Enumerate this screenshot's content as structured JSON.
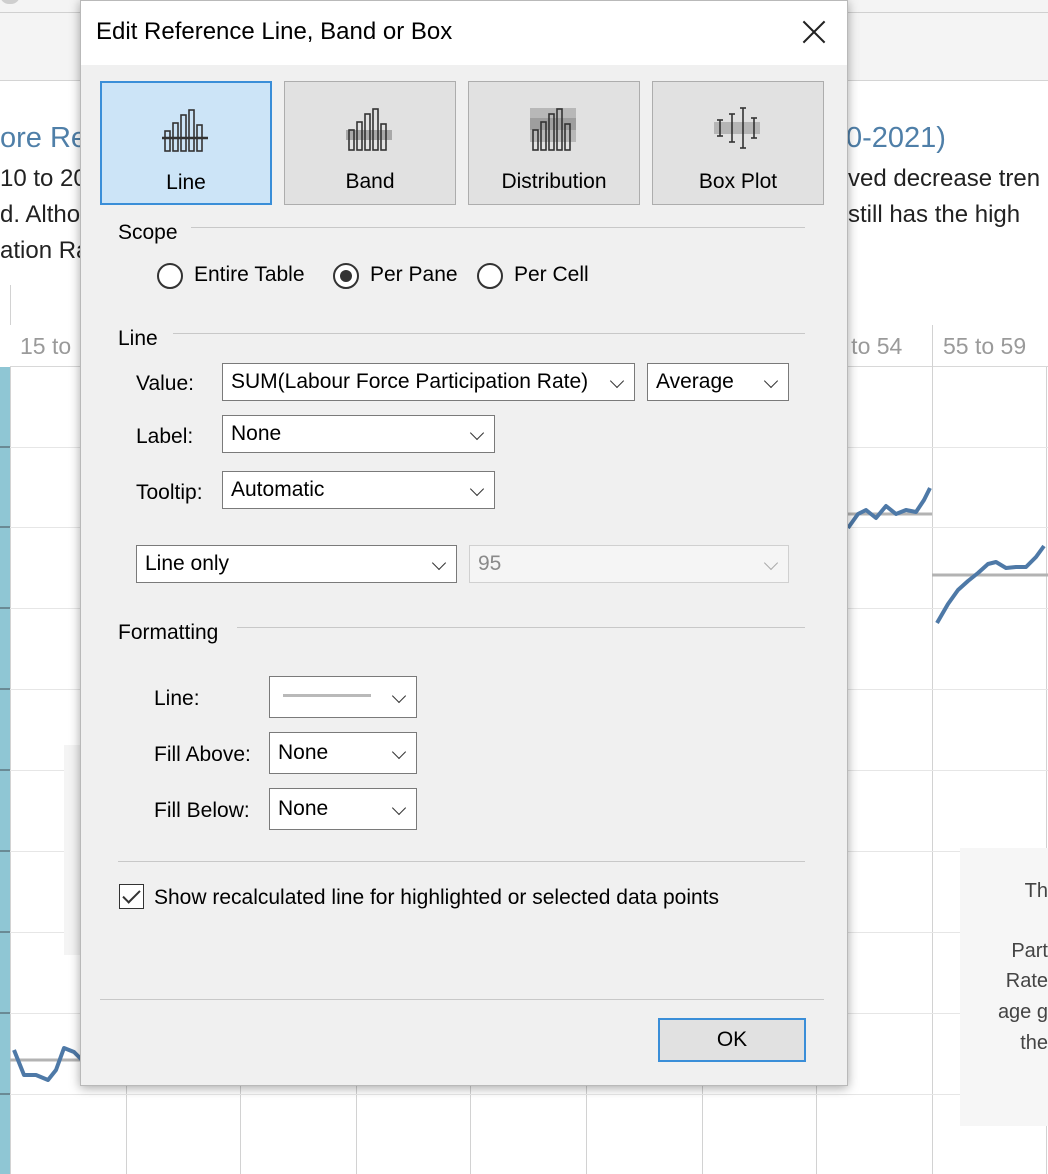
{
  "background": {
    "title_left": "ore Re",
    "title_right": "0-2021)",
    "text_left": [
      "10 to 20",
      "d. Altho",
      "ation Ra"
    ],
    "text_right": [
      "ved decrease tren",
      "still has the high"
    ],
    "col_headers": [
      "15 to",
      "0 to 54",
      "55 to 59"
    ],
    "side_card": [
      "Th",
      "Part",
      "Rate",
      "age g",
      "the"
    ]
  },
  "dialog": {
    "title": "Edit Reference Line, Band or Box",
    "tabs": [
      {
        "label": "Line",
        "selected": true
      },
      {
        "label": "Band",
        "selected": false
      },
      {
        "label": "Distribution",
        "selected": false
      },
      {
        "label": "Box Plot",
        "selected": false
      }
    ],
    "scope": {
      "label": "Scope",
      "options": [
        {
          "label": "Entire Table",
          "checked": false
        },
        {
          "label": "Per Pane",
          "checked": true
        },
        {
          "label": "Per Cell",
          "checked": false
        }
      ]
    },
    "line": {
      "label": "Line",
      "value_label": "Value:",
      "value_field": "SUM(Labour Force Participation Rate)",
      "aggregation": "Average",
      "label_label": "Label:",
      "label_value": "None",
      "tooltip_label": "Tooltip:",
      "tooltip_value": "Automatic",
      "display": "Line only",
      "confidence": "95"
    },
    "formatting": {
      "label": "Formatting",
      "line_label": "Line:",
      "fill_above_label": "Fill Above:",
      "fill_above_value": "None",
      "fill_below_label": "Fill Below:",
      "fill_below_value": "None",
      "line_color": "#b9b9b9"
    },
    "recalc_label": "Show recalculated line for highlighted or selected data points",
    "recalc_checked": true,
    "ok_label": "OK"
  },
  "colors": {
    "accent": "#3a8ed8",
    "selected_tab_bg": "#cce4f7",
    "series": "#4e79a7",
    "title_blue": "#4f7fa8",
    "teal": "#8fc6d4"
  }
}
